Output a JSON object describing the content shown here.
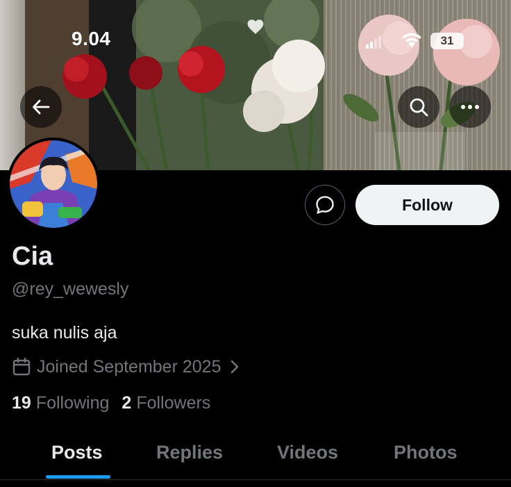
{
  "status_bar": {
    "time": "9.04",
    "battery": "31"
  },
  "profile": {
    "display_name": "Cia",
    "handle": "@rey_wewesly",
    "bio": "suka nulis aja",
    "joined": "Joined September 2025",
    "following_count": "19",
    "following_label": "Following",
    "followers_count": "2",
    "followers_label": "Followers"
  },
  "actions": {
    "follow_label": "Follow"
  },
  "tabs": [
    {
      "label": "Posts",
      "active": true
    },
    {
      "label": "Replies",
      "active": false
    },
    {
      "label": "Videos",
      "active": false
    },
    {
      "label": "Photos",
      "active": false
    }
  ],
  "icons": {
    "back": "arrow-left-icon",
    "search": "search-icon",
    "more": "more-horizontal-icon",
    "message": "chat-bubble-icon",
    "calendar": "calendar-icon",
    "chevron": "chevron-right-icon",
    "heart": "heart-icon",
    "signal": "signal-icon",
    "wifi": "wifi-icon"
  },
  "colors": {
    "background": "#000000",
    "primary_text": "#e7e9ea",
    "secondary_text": "#71767b",
    "accent": "#1d9bf0",
    "follow_button_bg": "#eff3f4"
  }
}
